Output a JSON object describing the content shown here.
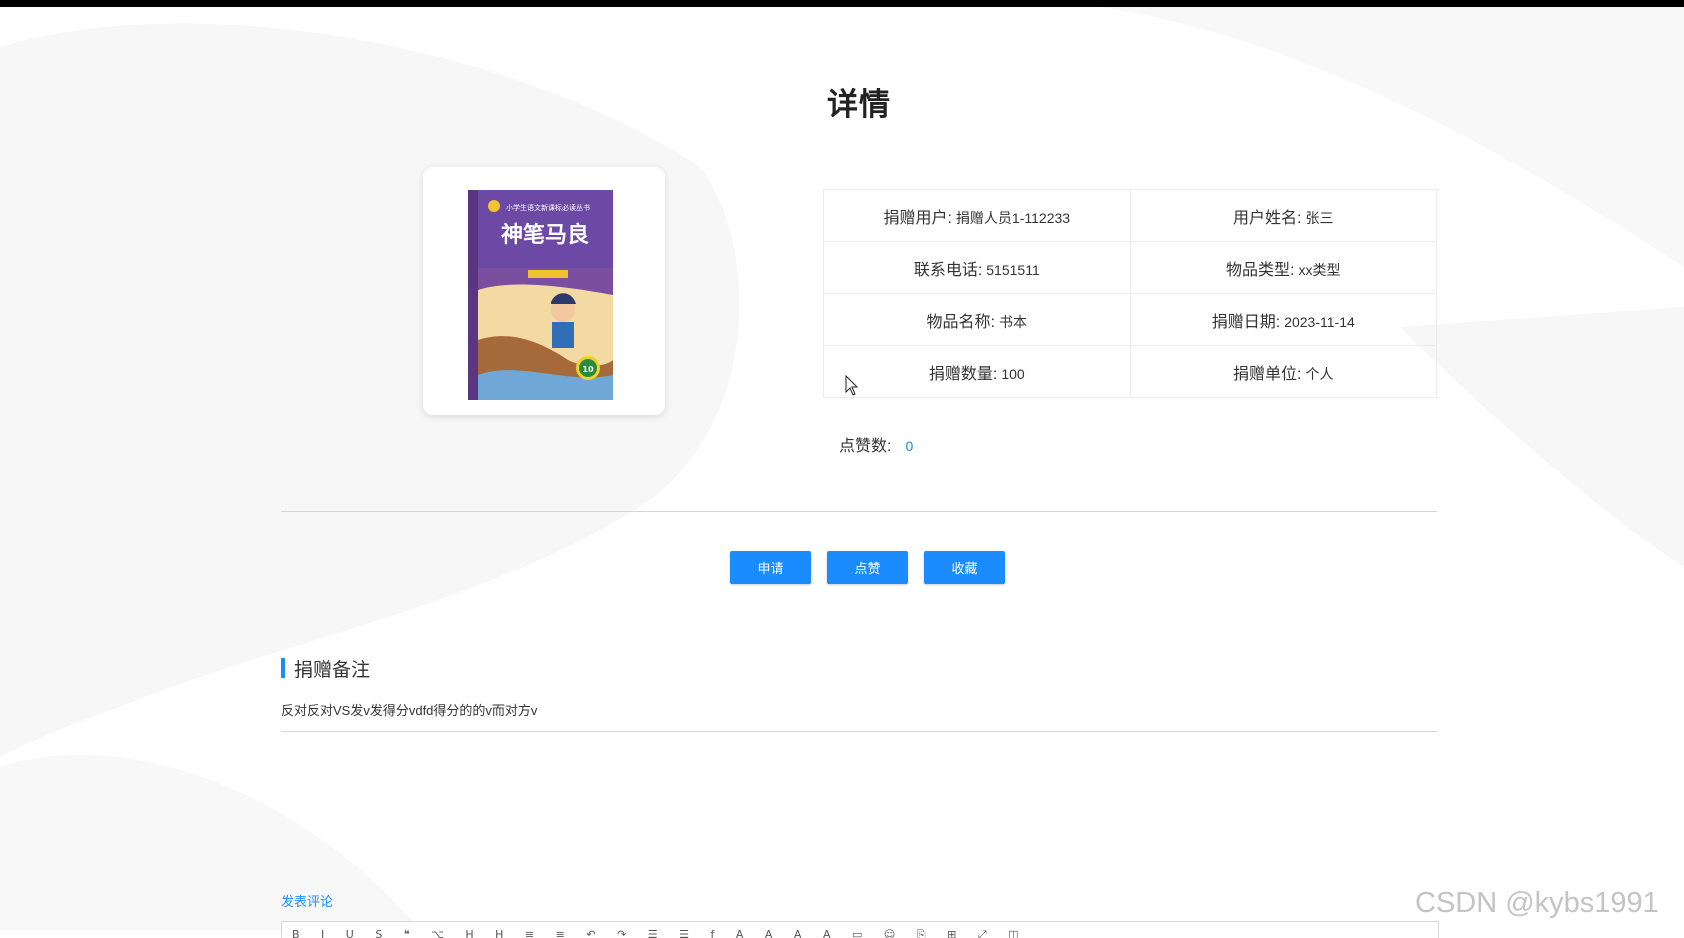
{
  "page": {
    "title": "详情"
  },
  "book_cover": {
    "series_line": "小学生语文新课标必读丛书",
    "title": "神笔马良",
    "badge": "10"
  },
  "info": {
    "rows": [
      [
        {
          "label": "捐赠用户:",
          "value": "捐赠人员1-112233"
        },
        {
          "label": "用户姓名:",
          "value": "张三"
        }
      ],
      [
        {
          "label": "联系电话:",
          "value": "5151511"
        },
        {
          "label": "物品类型:",
          "value": "xx类型"
        }
      ],
      [
        {
          "label": "物品名称:",
          "value": "书本"
        },
        {
          "label": "捐赠日期:",
          "value": "2023-11-14"
        }
      ],
      [
        {
          "label": "捐赠数量:",
          "value": "100"
        },
        {
          "label": "捐赠单位:",
          "value": "个人"
        }
      ]
    ],
    "likes_label": "点赞数:",
    "likes_value": "0"
  },
  "actions": {
    "apply": "申请",
    "like": "点赞",
    "favorite": "收藏"
  },
  "remark": {
    "title": "捐赠备注",
    "content": "反对反对VS发v发得分vdfd得分的的v而对方v"
  },
  "comment": {
    "label": "发表评论",
    "toolbar_glyphs": "B I U S ❝ ⌥ H H ≡ ≡ ↶ ↷ ☰ ☰ ƒ A A A A ▭ ☺ ⎘ ⊞ ⤢ ◫"
  },
  "watermark": "CSDN @kybs1991",
  "colors": {
    "accent": "#1a8cff",
    "link": "#1e88e5",
    "border": "#ececec",
    "divider": "#d6d6d6"
  }
}
